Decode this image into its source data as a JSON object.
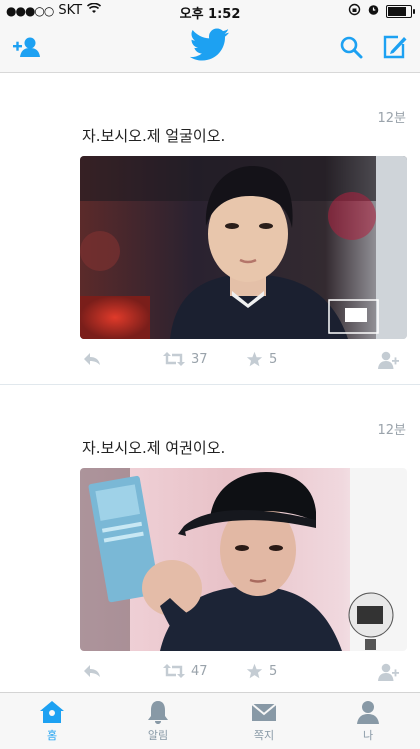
{
  "status_bar": {
    "signal": "●●●○○",
    "carrier": "SKT",
    "time": "오후 1:52",
    "battery_level": 0.85
  },
  "nav": {
    "icons": [
      "add-user-icon",
      "twitter-bird-icon",
      "search-icon",
      "compose-icon"
    ],
    "accent": "#1da1f2"
  },
  "tweets": [
    {
      "time": "12분",
      "text": "자.보시오.제 얼굴이오.",
      "retweets": "37",
      "likes": "5"
    },
    {
      "time": "12분",
      "text": "자.보시오.제 여권이오.",
      "retweets": "47",
      "likes": "5"
    }
  ],
  "tabs": [
    {
      "label": "홈",
      "icon": "home-icon",
      "active": true
    },
    {
      "label": "알림",
      "icon": "bell-icon",
      "active": false
    },
    {
      "label": "쪽지",
      "icon": "envelope-icon",
      "active": false
    },
    {
      "label": "나",
      "icon": "person-icon",
      "active": false
    }
  ]
}
